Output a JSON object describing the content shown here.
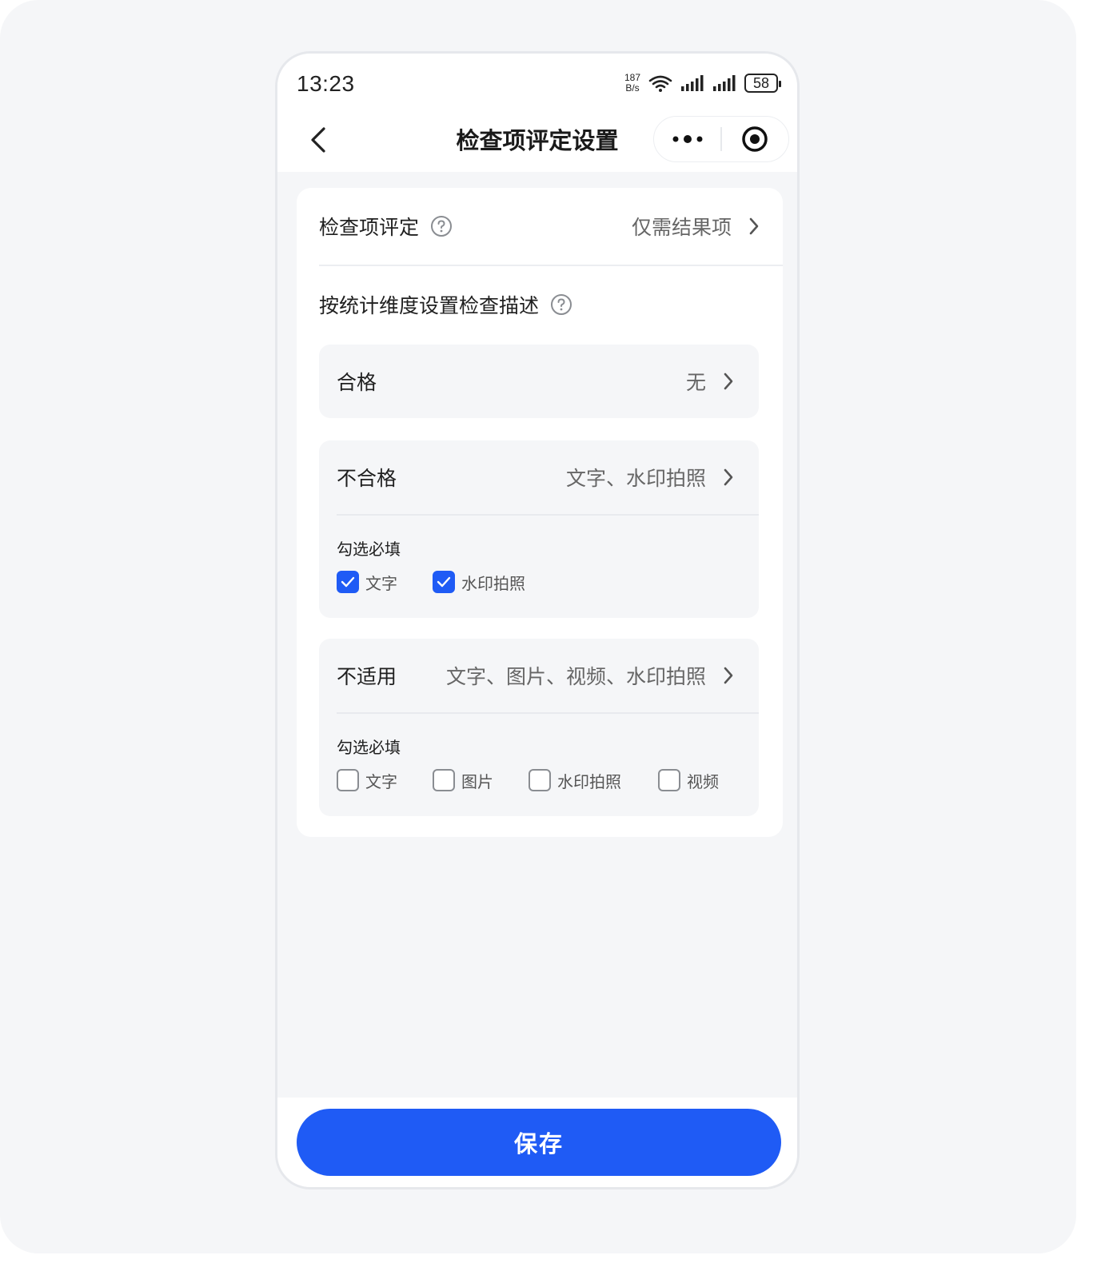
{
  "status_bar": {
    "time": "13:23",
    "net_speed_value": "187",
    "net_speed_unit": "B/s",
    "battery": "58"
  },
  "nav": {
    "title": "检查项评定设置"
  },
  "evaluation": {
    "label": "检查项评定",
    "value": "仅需结果项"
  },
  "dimension_section": {
    "title": "按统计维度设置检查描述"
  },
  "qualified": {
    "label": "合格",
    "value": "无"
  },
  "unqualified": {
    "label": "不合格",
    "value": "文字、水印拍照",
    "required_title": "勾选必填",
    "options": [
      {
        "label": "文字",
        "checked": true
      },
      {
        "label": "水印拍照",
        "checked": true
      }
    ]
  },
  "not_applicable": {
    "label": "不适用",
    "value": "文字、图片、视频、水印拍照",
    "required_title": "勾选必填",
    "options": [
      {
        "label": "文字",
        "checked": false
      },
      {
        "label": "图片",
        "checked": false
      },
      {
        "label": "水印拍照",
        "checked": false
      },
      {
        "label": "视频",
        "checked": false
      }
    ]
  },
  "footer": {
    "save_label": "保存"
  },
  "colors": {
    "primary": "#1f5bf5",
    "background": "#f5f6f8",
    "card": "#ffffff"
  }
}
